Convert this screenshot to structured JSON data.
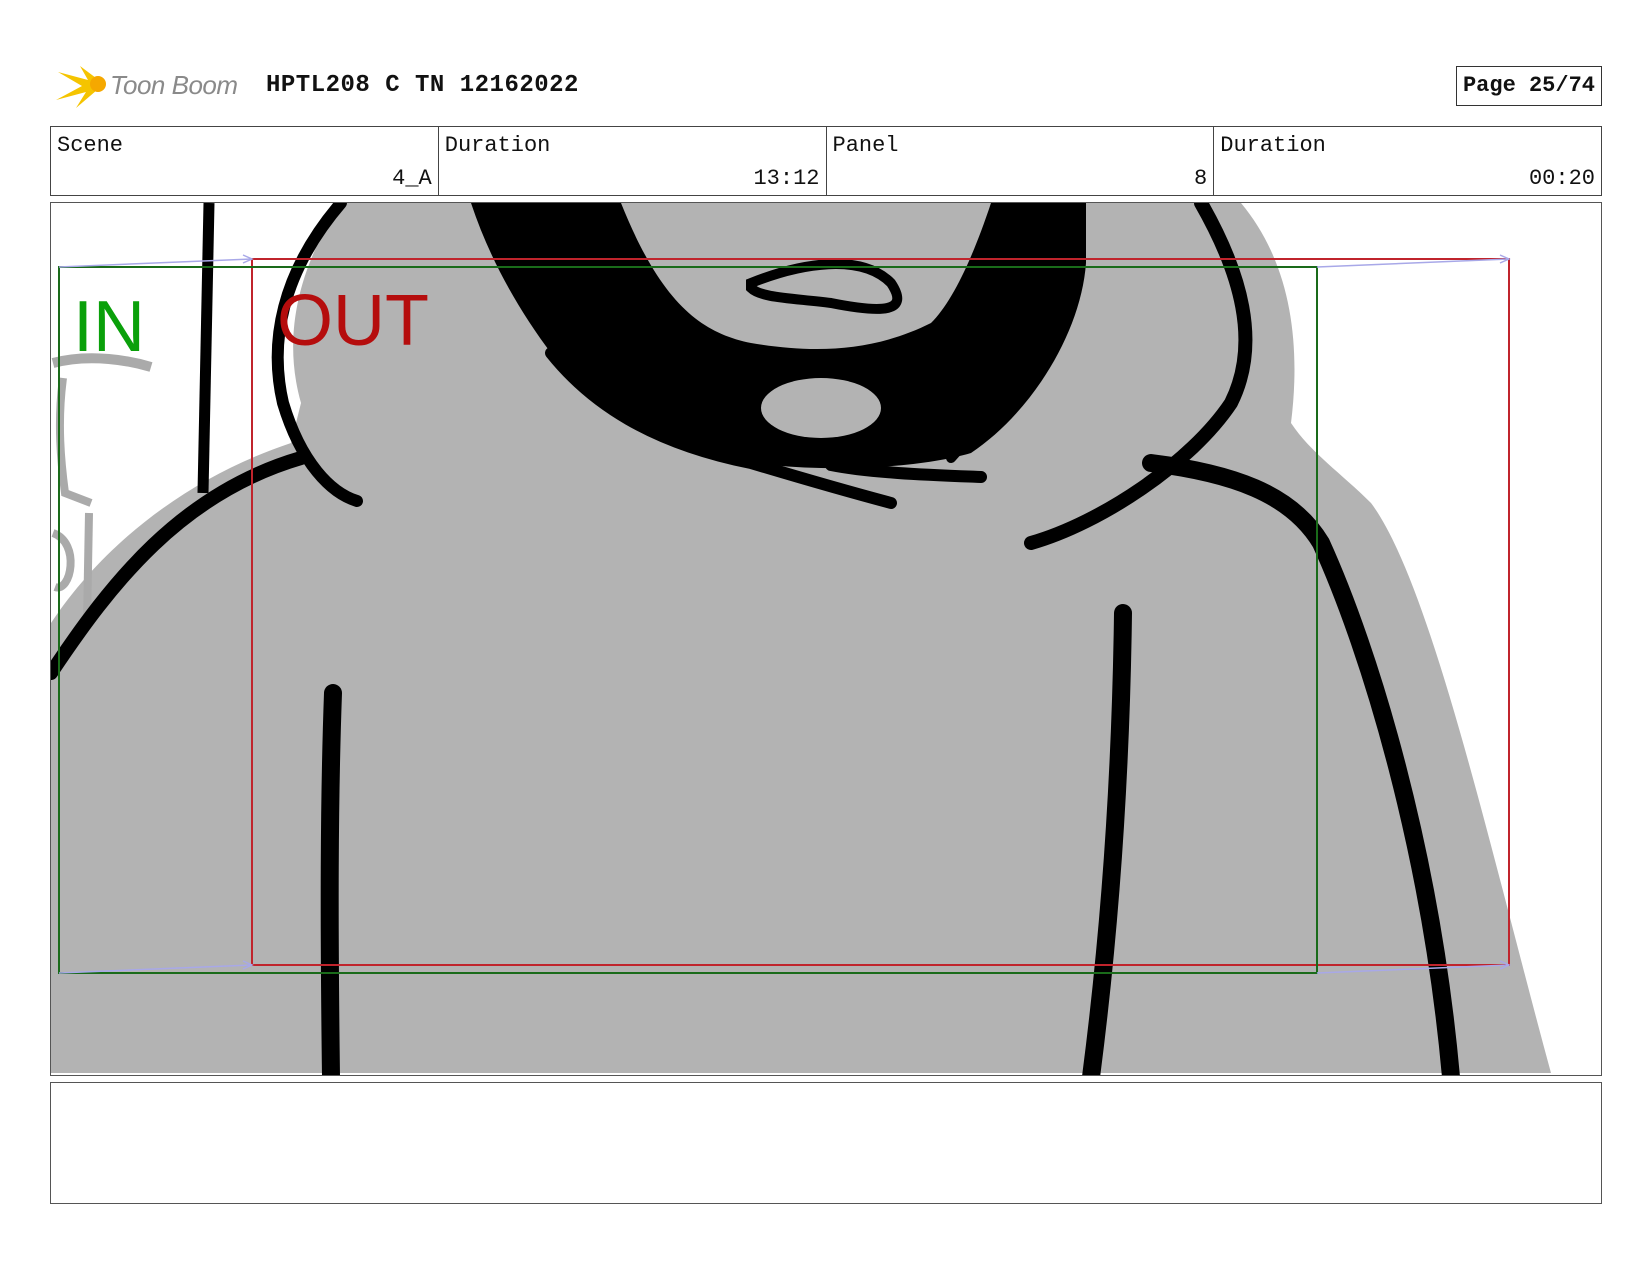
{
  "header": {
    "logo_text": "Toon Boom",
    "project_title": "HPTL208 C TN 12162022",
    "page_label": "Page 25/74"
  },
  "info": {
    "scene_label": "Scene",
    "scene_value": "4_A",
    "scene_duration_label": "Duration",
    "scene_duration_value": "13:12",
    "panel_label": "Panel",
    "panel_value": "8",
    "panel_duration_label": "Duration",
    "panel_duration_value": "00:20"
  },
  "frame": {
    "in_label": "IN",
    "out_label": "OUT",
    "in_color": "#0aa00a",
    "out_color": "#b50d0d",
    "fill_color": "#b3b3b3"
  },
  "notes": {
    "text": ""
  },
  "colors": {
    "logo_star": "#f5c400",
    "in_frame": "#1a6b1a",
    "out_frame": "#c0242c",
    "motion_arrow": "#a8a8e8"
  }
}
